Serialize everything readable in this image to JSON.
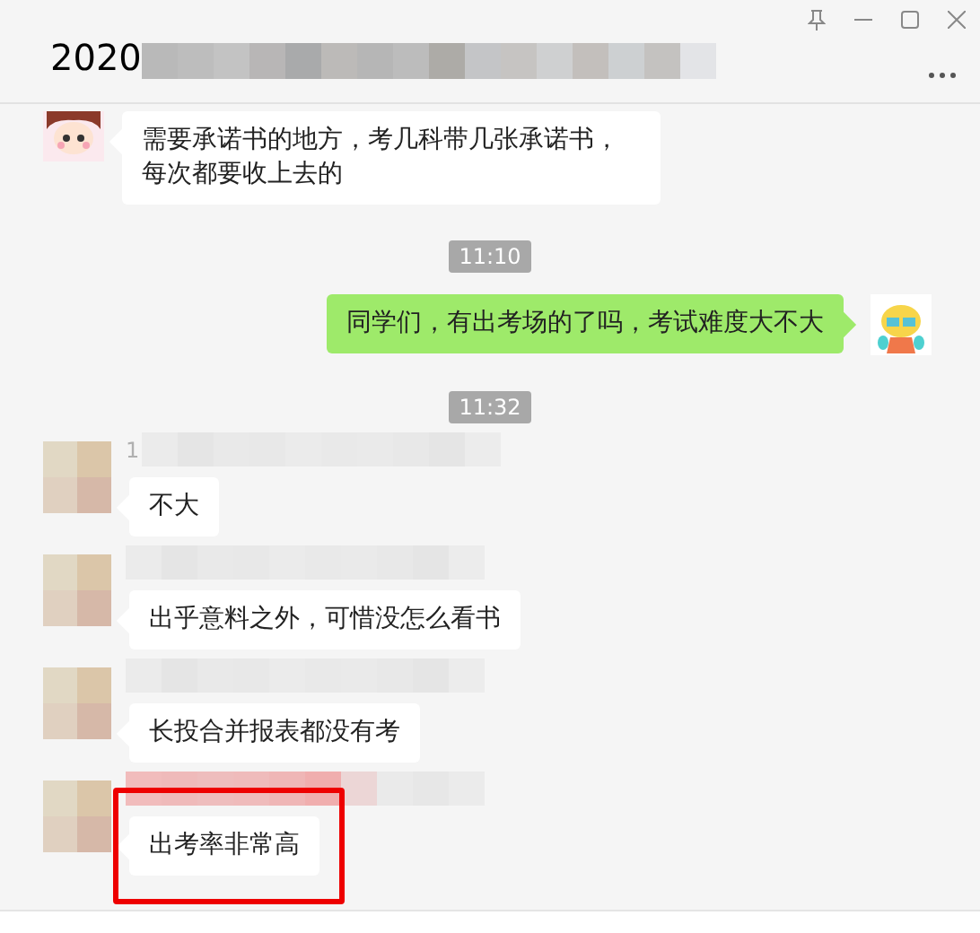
{
  "window": {
    "title": "2020"
  },
  "messages": [
    {
      "kind": "incoming",
      "text": "需要承诺书的地方，考几科带几张承诺书，每次都要收上去的",
      "highlighted": false
    },
    {
      "kind": "time",
      "text": "11:10"
    },
    {
      "kind": "outgoing",
      "text": "同学们，有出考场的了吗，考试难度大不大"
    },
    {
      "kind": "time",
      "text": "11:32"
    },
    {
      "kind": "incoming",
      "sender_name": "1",
      "text": "不大",
      "highlighted": false
    },
    {
      "kind": "incoming",
      "text": "出乎意料之外，可惜没怎么看书",
      "highlighted": false
    },
    {
      "kind": "incoming",
      "text": "长投合并报表都没有考",
      "highlighted": false
    },
    {
      "kind": "incoming",
      "text": "出考率非常高",
      "highlighted": true
    }
  ]
}
